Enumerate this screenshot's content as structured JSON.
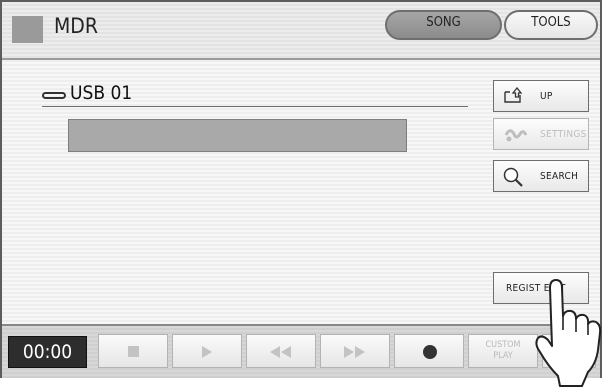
{
  "header": {
    "title": "MDR",
    "tabs": [
      "SONG",
      "TOOLS"
    ],
    "active_tab": "SONG"
  },
  "device": {
    "label": "USB 01"
  },
  "side_buttons": {
    "up": "UP",
    "settings": "SETTINGS",
    "search": "SEARCH",
    "regist_edit": "REGIST EDIT"
  },
  "transport": {
    "time": "00:00",
    "custom_play_line1": "CUSTOM",
    "custom_play_line2": "PLAY"
  },
  "icons": [
    "mdr-icon",
    "usb-icon",
    "folder-up-icon",
    "settings-icon",
    "search-icon",
    "stop-icon",
    "play-icon",
    "rewind-icon",
    "fast-forward-icon",
    "record-icon",
    "pointing-hand-icon"
  ]
}
